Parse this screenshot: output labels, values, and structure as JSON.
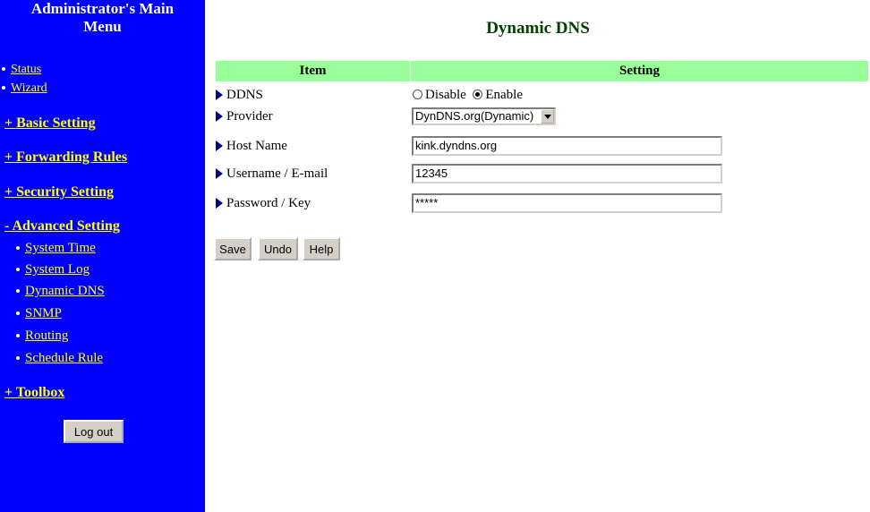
{
  "sidebar": {
    "title": "Administrator's Main\nMenu",
    "top_links": [
      "Status",
      "Wizard"
    ],
    "sections": {
      "basic": "+ Basic Setting",
      "forwarding": "+ Forwarding Rules",
      "security": "+ Security Setting",
      "advanced": "- Advanced Setting",
      "toolbox": "+ Toolbox"
    },
    "advanced_items": [
      "System Time",
      "System Log",
      "Dynamic DNS",
      "SNMP",
      "Routing",
      "Schedule Rule"
    ],
    "logout_label": "Log out"
  },
  "main": {
    "title": "Dynamic DNS",
    "headers": {
      "item": "Item",
      "setting": "Setting"
    },
    "rows": {
      "ddns": {
        "label": "DDNS",
        "options": [
          "Disable",
          "Enable"
        ],
        "selected": "Enable"
      },
      "provider": {
        "label": "Provider",
        "value": "DynDNS.org(Dynamic)"
      },
      "host": {
        "label": "Host Name",
        "value": "kink.dyndns.org"
      },
      "username": {
        "label": "Username / E-mail",
        "value": "12345"
      },
      "password": {
        "label": "Password / Key",
        "value": "*****"
      }
    },
    "buttons": {
      "save": "Save",
      "undo": "Undo",
      "help": "Help"
    }
  },
  "colors": {
    "sidebar_bg": "#0000ff",
    "link": "#ffff00",
    "header_bg": "#99ff99",
    "title": "#004000"
  }
}
